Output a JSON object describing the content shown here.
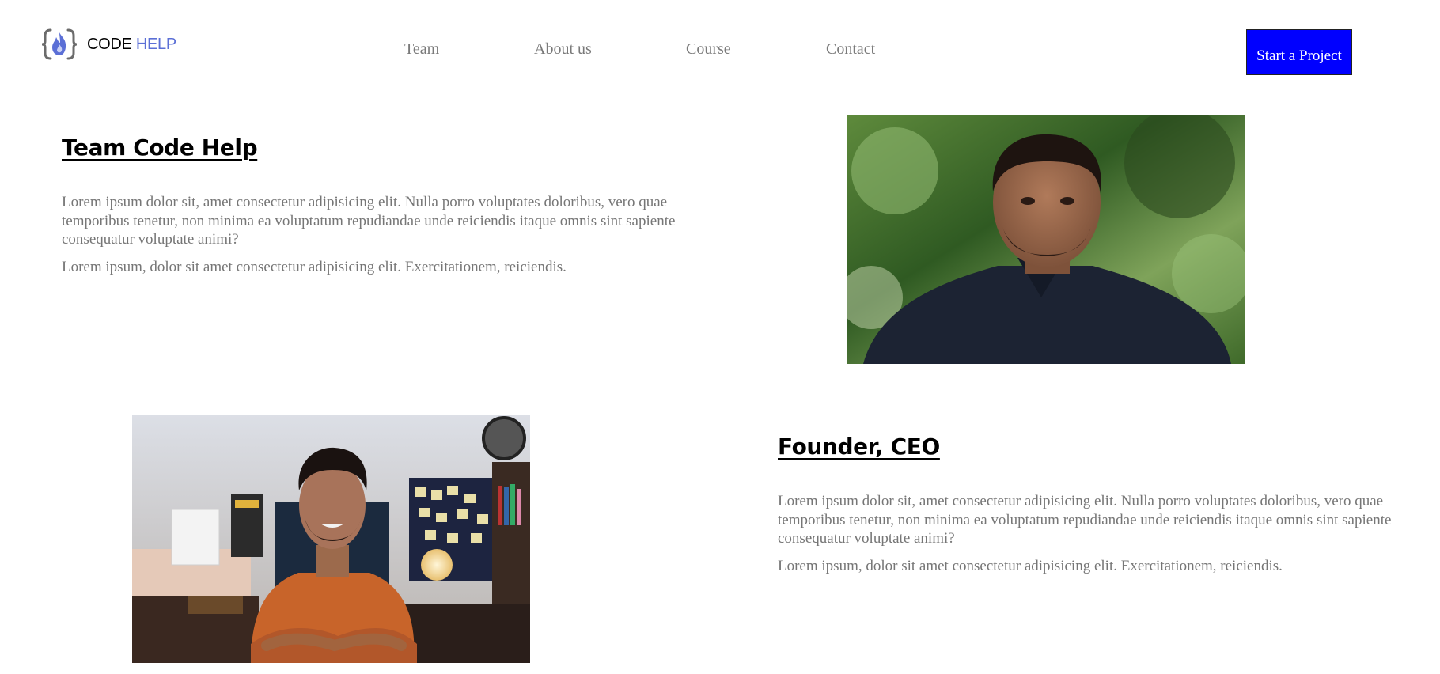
{
  "header": {
    "logo_code": "CODE",
    "logo_help": "HELP",
    "nav": [
      {
        "label": "Team"
      },
      {
        "label": "About us"
      },
      {
        "label": "Course"
      },
      {
        "label": "Contact"
      }
    ],
    "cta_label": "Start a Project"
  },
  "sections": [
    {
      "heading": "Team Code Help",
      "paragraph1": "Lorem ipsum dolor sit, amet consectetur adipisicing elit. Nulla porro voluptates doloribus, vero quae temporibus tenetur, non minima ea voluptatum repudiandae unde reiciendis itaque omnis sint sapiente consequatur voluptate animi?",
      "paragraph2": "Lorem ipsum, dolor sit amet consectetur adipisicing elit. Exercitationem, reiciendis."
    },
    {
      "heading": "Founder, CEO",
      "paragraph1": "Lorem ipsum dolor sit, amet consectetur adipisicing elit. Nulla porro voluptates doloribus, vero quae temporibus tenetur, non minima ea voluptatum repudiandae unde reiciendis itaque omnis sint sapiente consequatur voluptate animi?",
      "paragraph2": "Lorem ipsum, dolor sit amet consectetur adipisicing elit. Exercitationem, reiciendis."
    }
  ],
  "colors": {
    "brand_blue": "#0000ff",
    "logo_accent": "#5b6fd6",
    "text_gray": "#767676"
  },
  "icons": [
    "code-help-logo-icon",
    "team-member-photo",
    "founder-photo"
  ]
}
